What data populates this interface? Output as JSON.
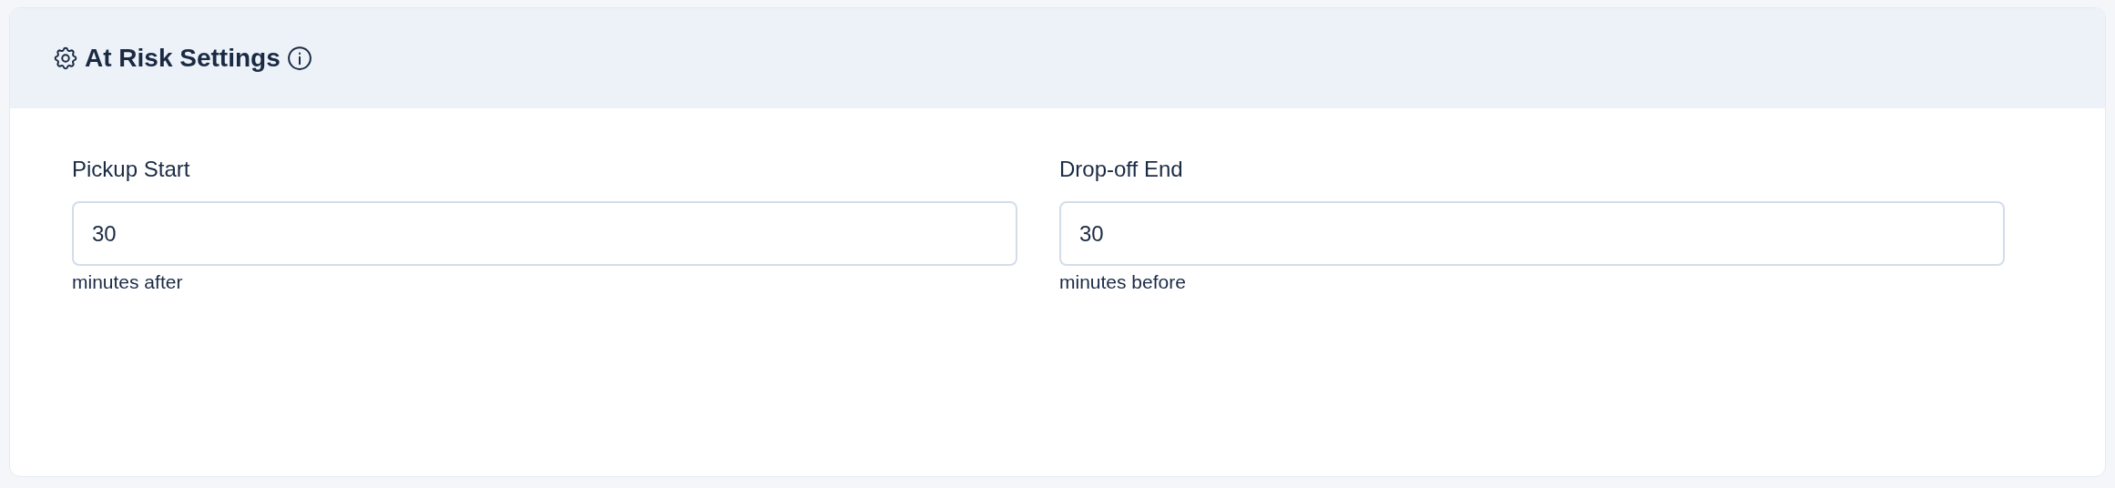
{
  "card": {
    "title": "At Risk Settings"
  },
  "fields": [
    {
      "label": "Pickup Start",
      "value": "30",
      "hint": "minutes after"
    },
    {
      "label": "Drop-off End",
      "value": "30",
      "hint": "minutes before"
    }
  ]
}
